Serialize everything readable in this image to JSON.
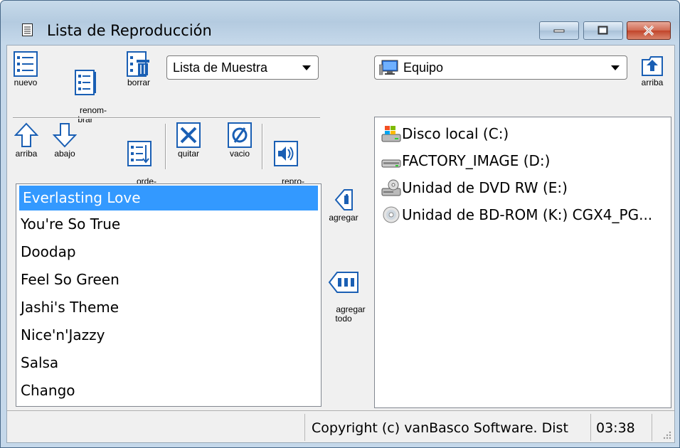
{
  "window": {
    "title": "Lista de Reproducción",
    "buttons": [
      "minimize",
      "maximize",
      "close"
    ]
  },
  "toolbar_top": {
    "nuevo": "nuevo",
    "renombrar": "renom-\nbrar",
    "borrar": "borrar",
    "playlist_combo": "Lista de Muestra",
    "location_combo": "Equipo",
    "arriba": "arriba"
  },
  "toolbar_list": {
    "arriba": "arriba",
    "abajo": "abajo",
    "ordenar": "orde-\nnar",
    "quitar": "quitar",
    "vacio": "vacio",
    "reproducir": "repro-\nducir"
  },
  "middle": {
    "agregar": "agregar",
    "agregar_todo": "agregar\ntodo"
  },
  "playlist": {
    "selected_index": 0,
    "songs": [
      "Everlasting Love",
      "You're So True",
      "Doodap",
      "Feel So Green",
      "Jashi's Theme",
      "Nice'n'Jazzy",
      "Salsa",
      "Chango"
    ]
  },
  "drives": [
    {
      "label": "Disco local (C:)",
      "icon": "local-disk-icon"
    },
    {
      "label": "FACTORY_IMAGE (D:)",
      "icon": "drive-icon"
    },
    {
      "label": "Unidad de DVD RW (E:)",
      "icon": "dvd-drive-icon"
    },
    {
      "label": "Unidad de BD-ROM (K:) CGX4_PG...",
      "icon": "optical-disc-icon"
    }
  ],
  "status": {
    "copyright": "Copyright (c) vanBasco Software. Dist",
    "time": "03:38"
  }
}
